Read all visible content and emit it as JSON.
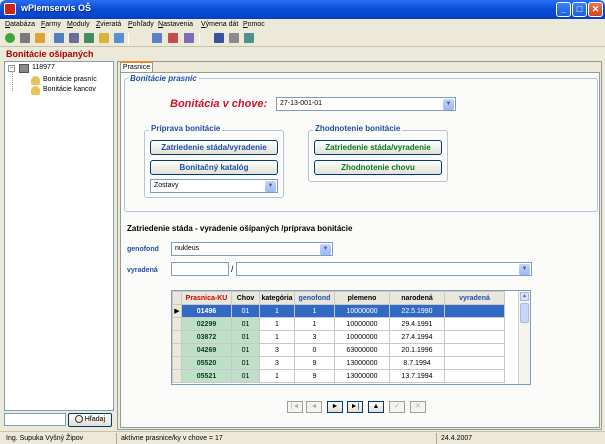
{
  "window": {
    "title": "wPlemservis OŠ",
    "min": "_",
    "max": "□",
    "close": "✕"
  },
  "menu": {
    "items": [
      {
        "u": "D",
        "rest": "atabáza"
      },
      {
        "u": "F",
        "rest": "army"
      },
      {
        "u": "M",
        "rest": "oduly"
      },
      {
        "u": "Z",
        "rest": "vieratá"
      },
      {
        "u": "P",
        "rest": "ohľady"
      },
      {
        "u": "N",
        "rest": "astavenia"
      },
      {
        "u": "V",
        "rest": "ýmena dát"
      },
      {
        "u": "P",
        "rest": "omoc"
      }
    ]
  },
  "colors": {
    "accent": "#1f4fa8",
    "title_red": "#d0112b",
    "selection": "#316ac5"
  },
  "section_title": "Bonitácie ošípaných",
  "tree": {
    "root": "118977",
    "children": [
      "Bonitácie prasníc",
      "Bonitácie kancov"
    ]
  },
  "search": {
    "value": "",
    "button_label": "Hľadaj",
    "icon": "search-icon"
  },
  "tab": {
    "label": "Prasnice"
  },
  "bonitacie_prasnic": {
    "legend": "Bonitácie prasníc",
    "bonitacia_label": "Bonitácia v chove:",
    "bonitacia_value": "27-13-001-01",
    "priprava": {
      "legend": "Príprava bonitácie",
      "btn_zatriedenie": "Zatriedenie stáda/vyradenie",
      "btn_katalog": "Bonitačný katalóg",
      "zostavy": "Zostavy"
    },
    "zhodnotenie": {
      "legend": "Zhodnotenie bonitácie",
      "btn_zatriedenie": "Zatriedenie stáda/vyradenie",
      "btn_chovu": "Zhodnotenie chovu"
    }
  },
  "lower": {
    "title": "Zatriedenie stáda - vyradenie ošípaných /príprava bonitácie",
    "genofond_label": "genofond",
    "genofond_value": "nukleus",
    "vyradena_label": "vyradená",
    "vyradena_value1": "",
    "separator": "/",
    "vyradena_value2": ""
  },
  "grid": {
    "columns": [
      "Prasnica-KU",
      "Chov",
      "kategória",
      "genofond",
      "plemeno",
      "narodená",
      "vyradená"
    ],
    "rows": [
      [
        "01496",
        "01",
        "1",
        "1",
        "10000000",
        "22.5.1990",
        ""
      ],
      [
        "02299",
        "01",
        "1",
        "1",
        "10000000",
        "29.4.1991",
        ""
      ],
      [
        "03872",
        "01",
        "1",
        "3",
        "10000000",
        "27.4.1994",
        ""
      ],
      [
        "04269",
        "01",
        "3",
        "0",
        "63000000",
        "20.1.1996",
        ""
      ],
      [
        "05520",
        "01",
        "3",
        "9",
        "13000000",
        "8.7.1994",
        ""
      ],
      [
        "05521",
        "01",
        "1",
        "9",
        "13000000",
        "13.7.1994",
        ""
      ]
    ],
    "selected_row": 0
  },
  "navigator": {
    "buttons": [
      {
        "name": "nav-first",
        "glyph": "|◄",
        "enabled": false
      },
      {
        "name": "nav-prev",
        "glyph": "◄",
        "enabled": false
      },
      {
        "name": "nav-next",
        "glyph": "►",
        "enabled": true
      },
      {
        "name": "nav-last",
        "glyph": "►|",
        "enabled": true
      },
      {
        "name": "nav-up",
        "glyph": "▲",
        "enabled": true
      },
      {
        "name": "nav-check",
        "glyph": "✓",
        "enabled": false
      },
      {
        "name": "nav-cancel",
        "glyph": "✕",
        "enabled": false
      }
    ]
  },
  "status": {
    "user": "Ing. Supuka Vyšný Žipov",
    "info": "aktívne prasnice/ky v chove = 17",
    "date": "24.4.2007"
  }
}
